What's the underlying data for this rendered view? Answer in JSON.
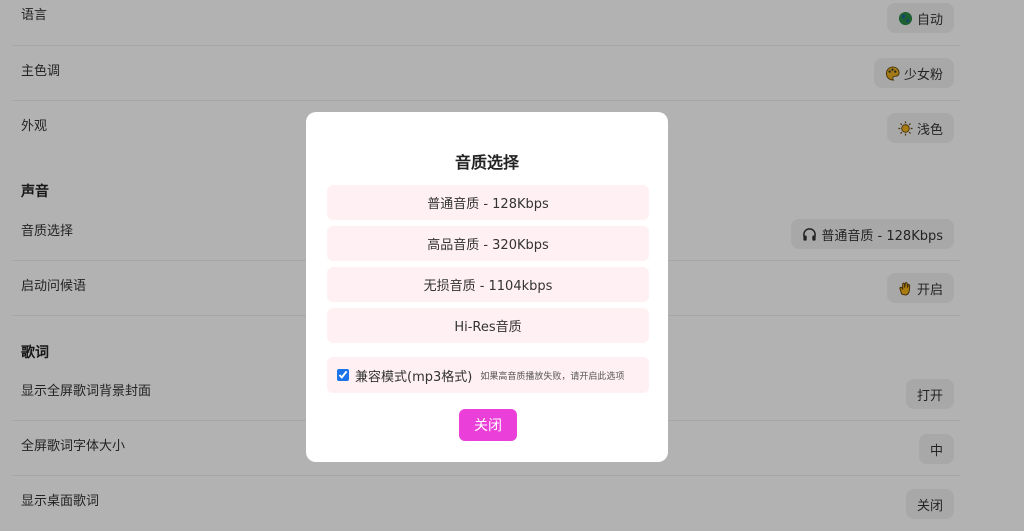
{
  "settings": {
    "language": {
      "label": "语言",
      "value": "自动",
      "icon": "globe-icon"
    },
    "theme_color": {
      "label": "主色调",
      "value": "少女粉",
      "icon": "palette-icon"
    },
    "appearance": {
      "label": "外观",
      "value": "浅色",
      "icon": "sun-icon"
    },
    "sound_section": "声音",
    "quality": {
      "label": "音质选择",
      "value": "普通音质 - 128Kbps",
      "icon": "headphones-icon"
    },
    "greeting": {
      "label": "启动问候语",
      "value": "开启",
      "icon": "hand-icon"
    },
    "lyrics_section": "歌词",
    "fullscreen_cover": {
      "label": "显示全屏歌词背景封面",
      "value": "打开"
    },
    "font_size": {
      "label": "全屏歌词字体大小",
      "value": "中"
    },
    "desktop_lyrics": {
      "label": "显示桌面歌词",
      "value": "关闭"
    }
  },
  "dialog": {
    "title": "音质选择",
    "options": [
      "普通音质 - 128Kbps",
      "高品音质 - 320Kbps",
      "无损音质 - 1104kbps",
      "Hi-Res音质"
    ],
    "compat_label": "兼容模式(mp3格式)",
    "compat_hint": "如果高音质播放失败，请开启此选项",
    "compat_checked": true,
    "close_label": "关闭"
  },
  "colors": {
    "accent": "#ea3fd8",
    "option_bg": "#fff0f3"
  }
}
